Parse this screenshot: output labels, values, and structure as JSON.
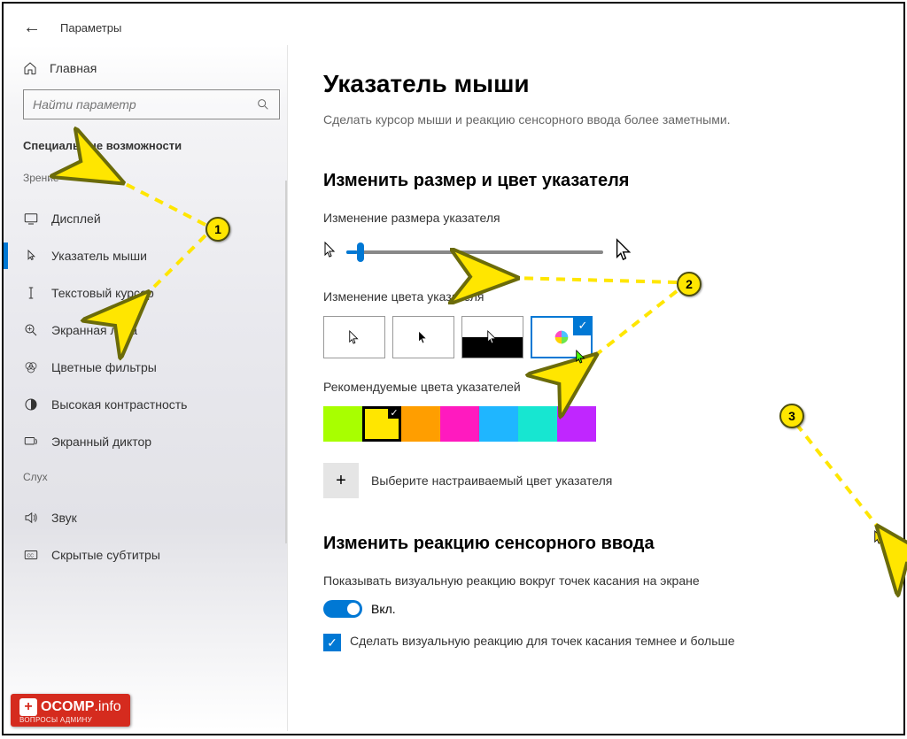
{
  "header": {
    "title": "Параметры"
  },
  "sidebar": {
    "home": "Главная",
    "search_placeholder": "Найти параметр",
    "group": "Специальные возможности",
    "vision_label": "Зрение",
    "hearing_label": "Слух",
    "items_vision": [
      {
        "icon": "display",
        "label": "Дисплей"
      },
      {
        "icon": "pointer",
        "label": "Указатель мыши",
        "active": true
      },
      {
        "icon": "text-cursor",
        "label": "Текстовый курсор"
      },
      {
        "icon": "magnifier",
        "label": "Экранная лупа"
      },
      {
        "icon": "color-filter",
        "label": "Цветные фильтры"
      },
      {
        "icon": "contrast",
        "label": "Высокая контрастность"
      },
      {
        "icon": "narrator",
        "label": "Экранный диктор"
      }
    ],
    "items_hearing": [
      {
        "icon": "sound",
        "label": "Звук"
      },
      {
        "icon": "cc",
        "label": "Скрытые субтитры"
      }
    ]
  },
  "main": {
    "h1": "Указатель мыши",
    "desc": "Сделать курсор мыши и реакцию сенсорного ввода более заметными.",
    "h2_size": "Изменить размер и цвет указателя",
    "size_label": "Изменение размера указателя",
    "color_label": "Изменение цвета указателя",
    "rec_label": "Рекомендуемые цвета указателей",
    "custom_label": "Выберите настраиваемый цвет указателя",
    "h2_touch": "Изменить реакцию сенсорного ввода",
    "touch_desc": "Показывать визуальную реакцию вокруг точек касания на экране",
    "toggle_state": "Вкл.",
    "check_label": "Сделать визуальную реакцию для точек касания темнее и больше",
    "swatches": [
      "#a8ff00",
      "#ffe600",
      "#ff9e00",
      "#ff1abf",
      "#1fb6ff",
      "#17e6d1",
      "#c026ff"
    ],
    "selected_swatch": 1,
    "color_options": [
      "white",
      "black",
      "inverted",
      "custom"
    ],
    "selected_color_option": 3
  },
  "annotations": {
    "b1": "1",
    "b2": "2",
    "b3": "3"
  },
  "watermark": {
    "brand": "OCOMP",
    "tld": ".info",
    "sub": "ВОПРОСЫ АДМИНУ"
  }
}
